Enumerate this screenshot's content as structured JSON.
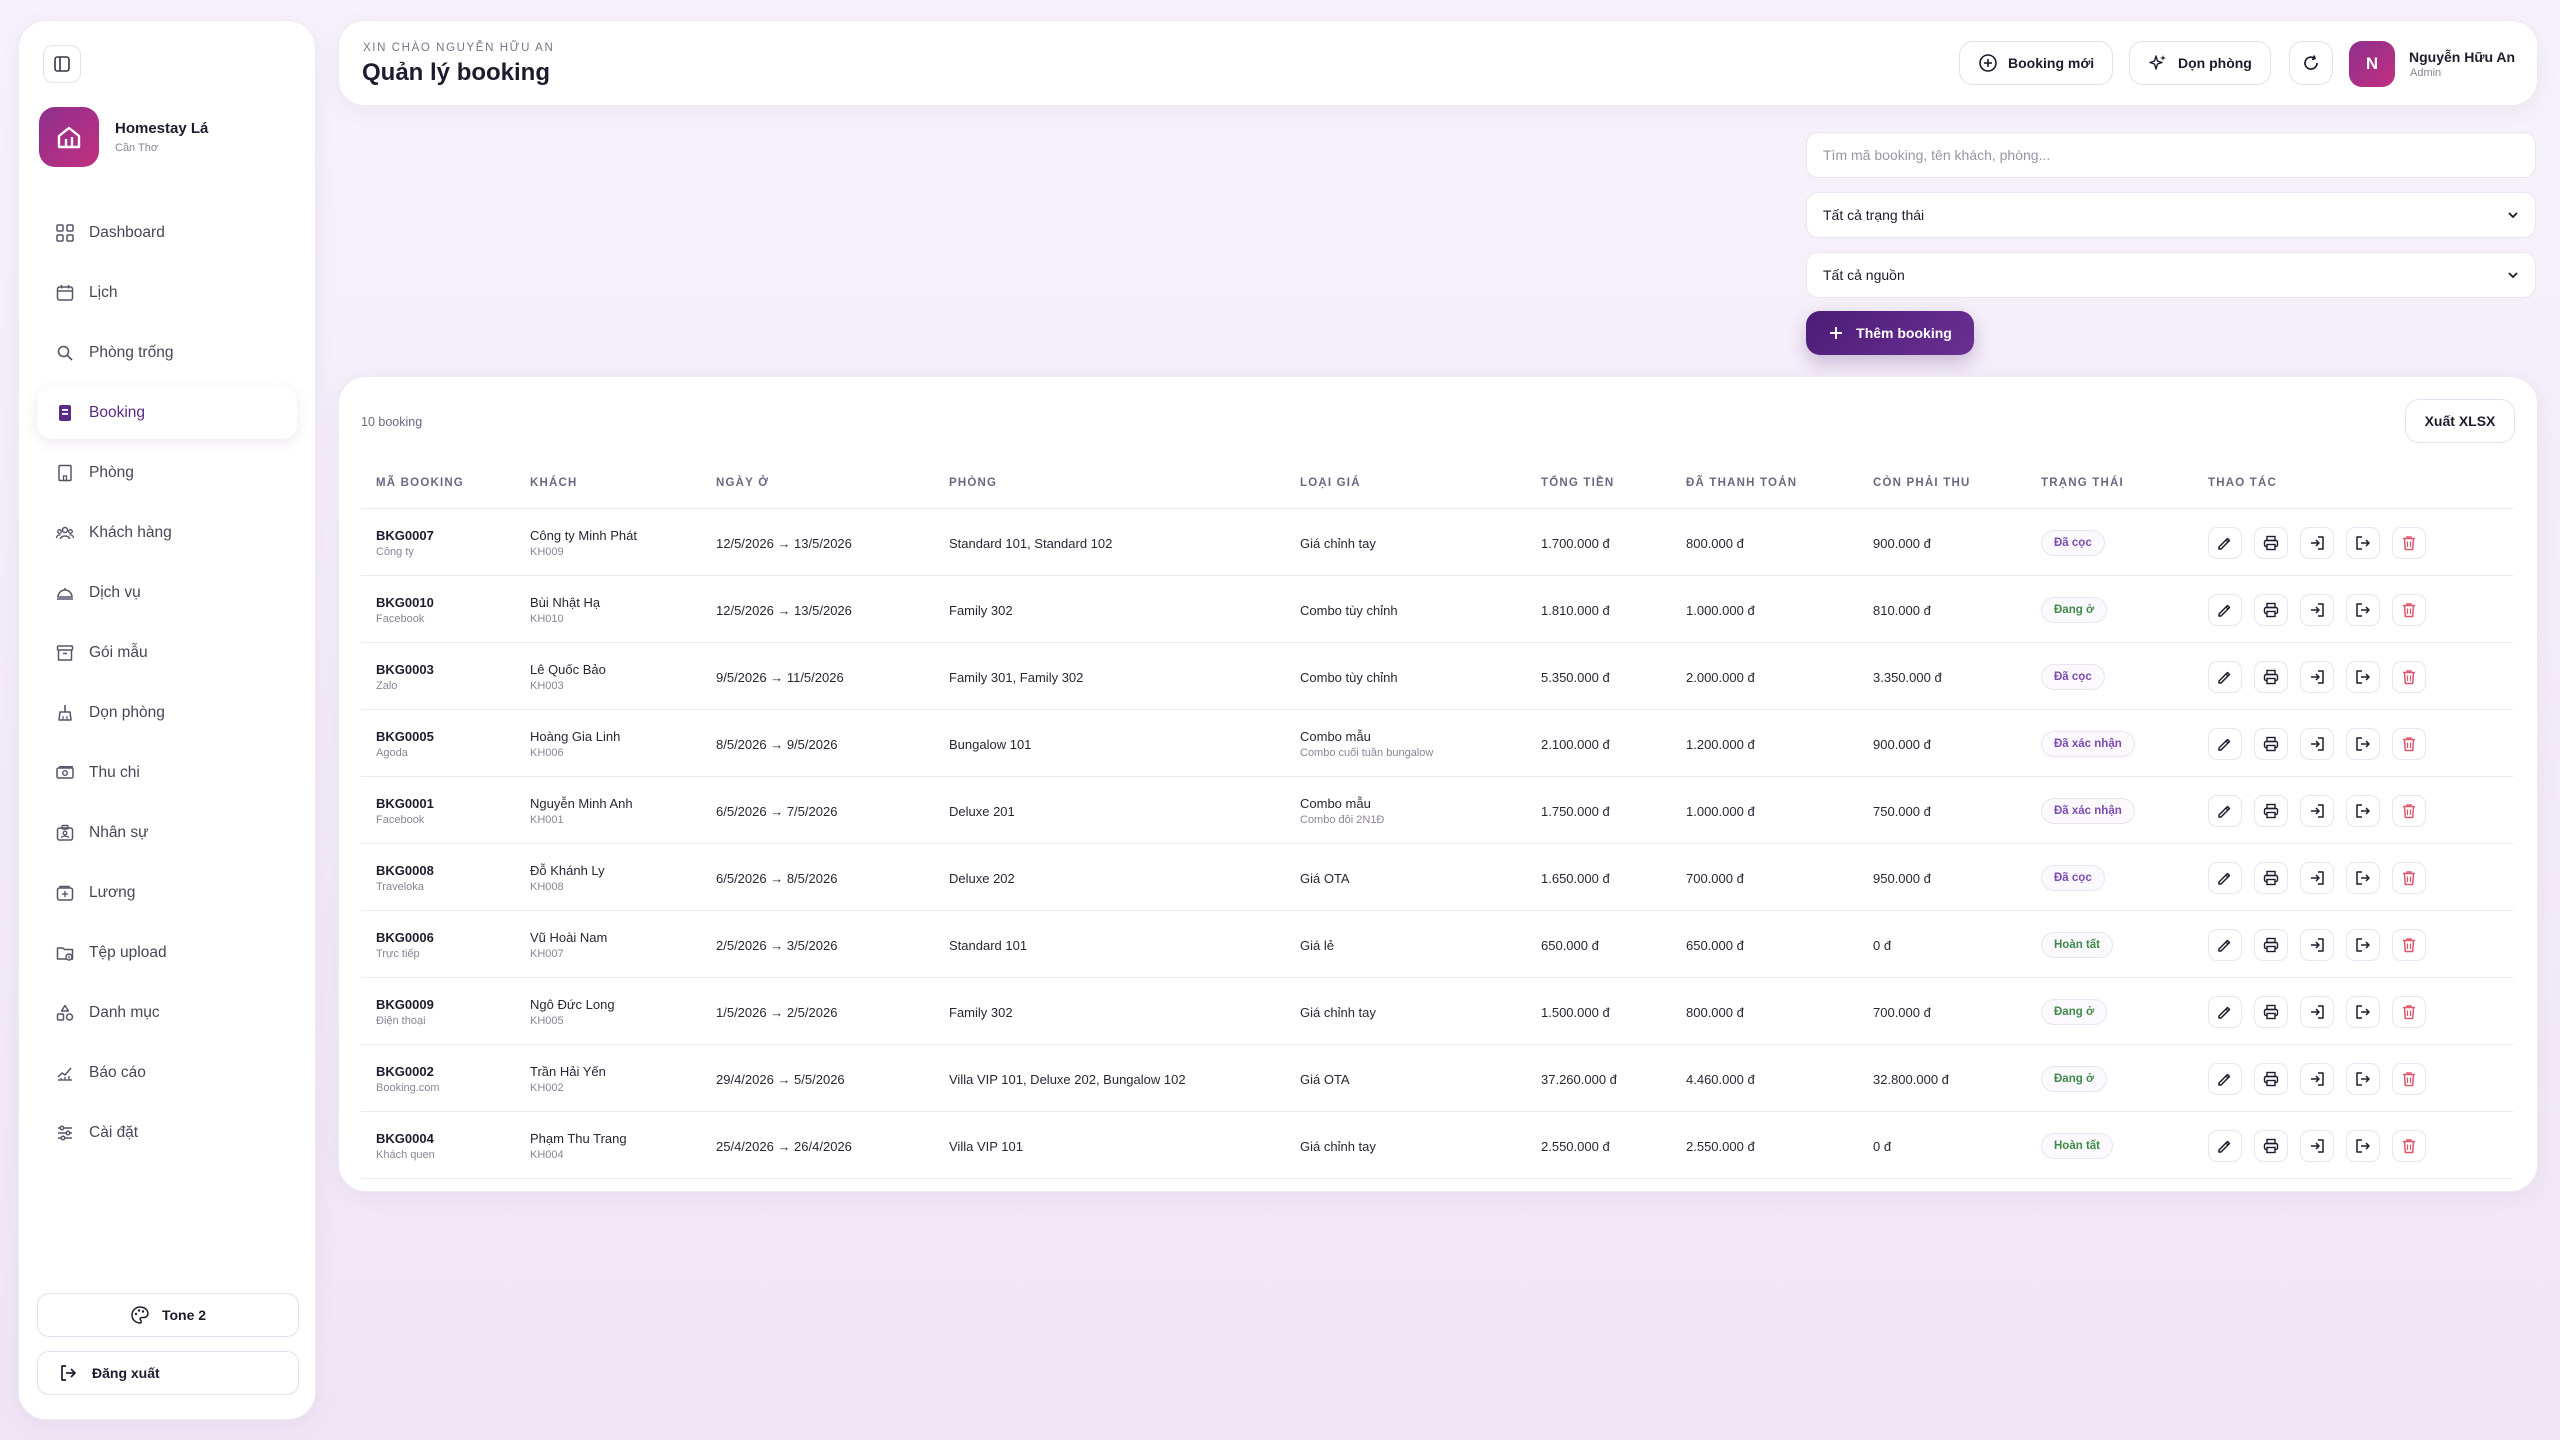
{
  "sidebar": {
    "brand_name": "Homestay Lá",
    "brand_sub": "Cần Thơ",
    "items": [
      {
        "label": "Dashboard",
        "icon": "grid-icon"
      },
      {
        "label": "Lịch",
        "icon": "calendar-icon"
      },
      {
        "label": "Phòng trống",
        "icon": "search-icon"
      },
      {
        "label": "Booking",
        "icon": "booking-icon"
      },
      {
        "label": "Phòng",
        "icon": "building-icon"
      },
      {
        "label": "Khách hàng",
        "icon": "users-icon"
      },
      {
        "label": "Dịch vụ",
        "icon": "service-icon"
      },
      {
        "label": "Gói mẫu",
        "icon": "archive-icon"
      },
      {
        "label": "Dọn phòng",
        "icon": "broom-icon"
      },
      {
        "label": "Thu chi",
        "icon": "money-icon"
      },
      {
        "label": "Nhân sự",
        "icon": "badge-icon"
      },
      {
        "label": "Lương",
        "icon": "wallet-icon"
      },
      {
        "label": "Tệp upload",
        "icon": "folder-icon"
      },
      {
        "label": "Danh mục",
        "icon": "shapes-icon"
      },
      {
        "label": "Báo cáo",
        "icon": "chart-icon"
      },
      {
        "label": "Cài đặt",
        "icon": "sliders-icon"
      }
    ],
    "active": "Booking",
    "tone_label": "Tone 2",
    "logout_label": "Đăng xuất"
  },
  "header": {
    "greeting": "XIN CHÀO NGUYỄN HỮU AN",
    "title": "Quản lý booking",
    "new_booking_label": "Booking mới",
    "cleaning_label": "Dọn phòng",
    "avatar_initial": "N",
    "user_name": "Nguyễn Hữu An",
    "user_role": "Admin"
  },
  "filters": {
    "search_placeholder": "Tìm mã booking, tên khách, phòng...",
    "status_value": "Tất cả trạng thái",
    "source_value": "Tất cả nguồn",
    "add_label": "Thêm booking"
  },
  "table": {
    "count_label": "10 booking",
    "export_label": "Xuất XLSX",
    "columns": [
      "MÃ BOOKING",
      "KHÁCH",
      "NGÀY Ở",
      "PHÒNG",
      "LOẠI GIÁ",
      "TỔNG TIỀN",
      "ĐÃ THANH TOÁN",
      "CÒN PHẢI THU",
      "TRẠNG THÁI",
      "THAO TÁC"
    ],
    "rows": [
      {
        "code": "BKG0007",
        "source": "Công ty",
        "guest": "Công ty Minh Phát",
        "guest_id": "KH009",
        "dates": "12/5/2026 → 13/5/2026",
        "rooms": "Standard 101, Standard 102",
        "rate": "Giá chỉnh tay",
        "rate_sub": "",
        "total": "1.700.000 đ",
        "paid": "800.000 đ",
        "due": "900.000 đ",
        "status": "Đã cọc",
        "status_color": "purple"
      },
      {
        "code": "BKG0010",
        "source": "Facebook",
        "guest": "Bùi Nhật Hạ",
        "guest_id": "KH010",
        "dates": "12/5/2026 → 13/5/2026",
        "rooms": "Family 302",
        "rate": "Combo tùy chỉnh",
        "rate_sub": "",
        "total": "1.810.000 đ",
        "paid": "1.000.000 đ",
        "due": "810.000 đ",
        "status": "Đang ở",
        "status_color": "green"
      },
      {
        "code": "BKG0003",
        "source": "Zalo",
        "guest": "Lê Quốc Bảo",
        "guest_id": "KH003",
        "dates": "9/5/2026 → 11/5/2026",
        "rooms": "Family 301, Family 302",
        "rate": "Combo tùy chỉnh",
        "rate_sub": "",
        "total": "5.350.000 đ",
        "paid": "2.000.000 đ",
        "due": "3.350.000 đ",
        "status": "Đã cọc",
        "status_color": "purple"
      },
      {
        "code": "BKG0005",
        "source": "Agoda",
        "guest": "Hoàng Gia Linh",
        "guest_id": "KH006",
        "dates": "8/5/2026 → 9/5/2026",
        "rooms": "Bungalow 101",
        "rate": "Combo mẫu",
        "rate_sub": "Combo cuối tuần bungalow",
        "total": "2.100.000 đ",
        "paid": "1.200.000 đ",
        "due": "900.000 đ",
        "status": "Đã xác nhận",
        "status_color": "purple"
      },
      {
        "code": "BKG0001",
        "source": "Facebook",
        "guest": "Nguyễn Minh Anh",
        "guest_id": "KH001",
        "dates": "6/5/2026 → 7/5/2026",
        "rooms": "Deluxe 201",
        "rate": "Combo mẫu",
        "rate_sub": "Combo đôi 2N1Đ",
        "total": "1.750.000 đ",
        "paid": "1.000.000 đ",
        "due": "750.000 đ",
        "status": "Đã xác nhận",
        "status_color": "purple"
      },
      {
        "code": "BKG0008",
        "source": "Traveloka",
        "guest": "Đỗ Khánh Ly",
        "guest_id": "KH008",
        "dates": "6/5/2026 → 8/5/2026",
        "rooms": "Deluxe 202",
        "rate": "Giá OTA",
        "rate_sub": "",
        "total": "1.650.000 đ",
        "paid": "700.000 đ",
        "due": "950.000 đ",
        "status": "Đã cọc",
        "status_color": "purple"
      },
      {
        "code": "BKG0006",
        "source": "Trực tiếp",
        "guest": "Vũ Hoài Nam",
        "guest_id": "KH007",
        "dates": "2/5/2026 → 3/5/2026",
        "rooms": "Standard 101",
        "rate": "Giá lẻ",
        "rate_sub": "",
        "total": "650.000 đ",
        "paid": "650.000 đ",
        "due": "0 đ",
        "status": "Hoàn tất",
        "status_color": "green"
      },
      {
        "code": "BKG0009",
        "source": "Điện thoại",
        "guest": "Ngô Đức Long",
        "guest_id": "KH005",
        "dates": "1/5/2026 → 2/5/2026",
        "rooms": "Family 302",
        "rate": "Giá chỉnh tay",
        "rate_sub": "",
        "total": "1.500.000 đ",
        "paid": "800.000 đ",
        "due": "700.000 đ",
        "status": "Đang ở",
        "status_color": "green"
      },
      {
        "code": "BKG0002",
        "source": "Booking.com",
        "guest": "Trần Hải Yến",
        "guest_id": "KH002",
        "dates": "29/4/2026 → 5/5/2026",
        "rooms": "Villa VIP 101, Deluxe 202, Bungalow 102",
        "rate": "Giá OTA",
        "rate_sub": "",
        "total": "37.260.000 đ",
        "paid": "4.460.000 đ",
        "due": "32.800.000 đ",
        "status": "Đang ở",
        "status_color": "green"
      },
      {
        "code": "BKG0004",
        "source": "Khách quen",
        "guest": "Phạm Thu Trang",
        "guest_id": "KH004",
        "dates": "25/4/2026 → 26/4/2026",
        "rooms": "Villa VIP 101",
        "rate": "Giá chỉnh tay",
        "rate_sub": "",
        "total": "2.550.000 đ",
        "paid": "2.550.000 đ",
        "due": "0 đ",
        "status": "Hoàn tất",
        "status_color": "green"
      }
    ]
  },
  "colors": {
    "accent": "#5b2a86",
    "brand_gradient_start": "#8e2f8f",
    "brand_gradient_end": "#c2307e",
    "status_purple": "#7b4ab3",
    "status_green": "#3f8a4a",
    "delete_red": "#e0566b"
  }
}
